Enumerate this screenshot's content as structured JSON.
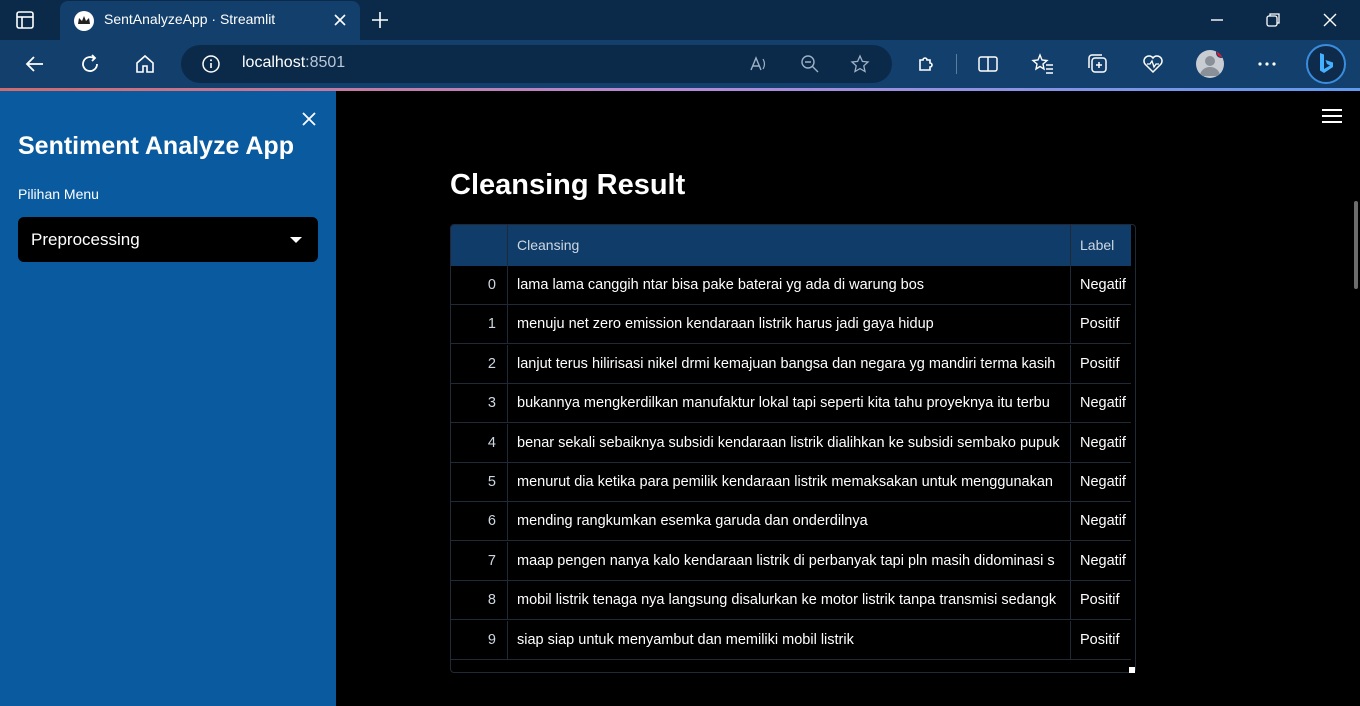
{
  "browser": {
    "tab_title": "SentAnalyzeApp · Streamlit",
    "url_host": "localhost",
    "url_port": ":8501"
  },
  "sidebar": {
    "app_title": "Sentiment Analyze App",
    "menu_label": "Pilihan Menu",
    "menu_selected": "Preprocessing"
  },
  "main": {
    "title": "Cleansing Result",
    "table": {
      "columns": [
        "Cleansing",
        "Label"
      ],
      "rows": [
        {
          "index": "0",
          "text": "lama lama canggih   ntar bisa pake baterai yg ada di warung bos",
          "label": "Negatif"
        },
        {
          "index": "1",
          "text": "menuju net zero emission kendaraan listrik harus jadi gaya hidup",
          "label": "Positif"
        },
        {
          "index": "2",
          "text": "lanjut terus hilirisasi nikel drmi kemajuan bangsa dan negara yg mandiri terma kasih",
          "label": "Positif"
        },
        {
          "index": "3",
          "text": "  bukannya mengkerdilkan manufaktur lokal tapi seperti kita tahu proyeknya itu terbu",
          "label": "Negatif"
        },
        {
          "index": "4",
          "text": "benar sekali sebaiknya subsidi kendaraan listrik dialihkan ke subsidi sembako pupuk",
          "label": "Negatif"
        },
        {
          "index": "5",
          "text": "menurut dia  ketika para pemilik kendaraan listrik memaksakan untuk menggunakan",
          "label": "Negatif"
        },
        {
          "index": "6",
          "text": "mending rangkumkan esemka garuda dan onderdilnya",
          "label": "Negatif"
        },
        {
          "index": "7",
          "text": "maap pengen nanya  kalo kendaraan listrik di perbanyak  tapi pln masih didominasi s",
          "label": "Negatif"
        },
        {
          "index": "8",
          "text": "mobil listrik tenaga nya langsung disalurkan ke motor listrik tanpa transmisi  sedangk",
          "label": "Positif"
        },
        {
          "index": "9",
          "text": "siap siap untuk menyambut dan memiliki mobil listrik",
          "label": "Positif"
        }
      ]
    }
  },
  "colors": {
    "sidebar_bg": "#0a5aa0",
    "header_bg": "#0f3c68",
    "browser_bg": "#123f6b"
  }
}
